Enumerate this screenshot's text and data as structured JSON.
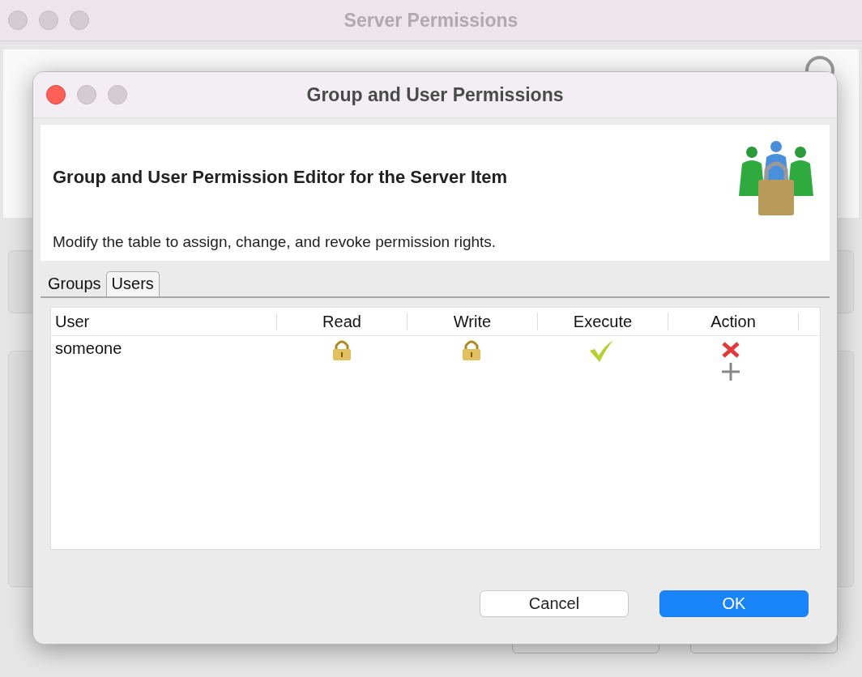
{
  "background_window": {
    "title": "Server Permissions"
  },
  "dialog": {
    "title": "Group and User Permissions",
    "heading": "Group and User Permission Editor for the Server Item",
    "description": "Modify the table to assign, change, and revoke permission rights.",
    "tabs": [
      {
        "label": "Groups",
        "selected": false
      },
      {
        "label": "Users",
        "selected": true
      }
    ],
    "table": {
      "columns": [
        "User",
        "Read",
        "Write",
        "Execute",
        "Action"
      ],
      "rows": [
        {
          "user": "someone",
          "permissions": [
            {
              "allowed": false
            },
            {
              "allowed": false
            },
            {
              "allowed": true
            }
          ]
        }
      ]
    },
    "buttons": [
      {
        "label": "Cancel",
        "default": false
      },
      {
        "label": "OK",
        "default": true
      }
    ]
  }
}
